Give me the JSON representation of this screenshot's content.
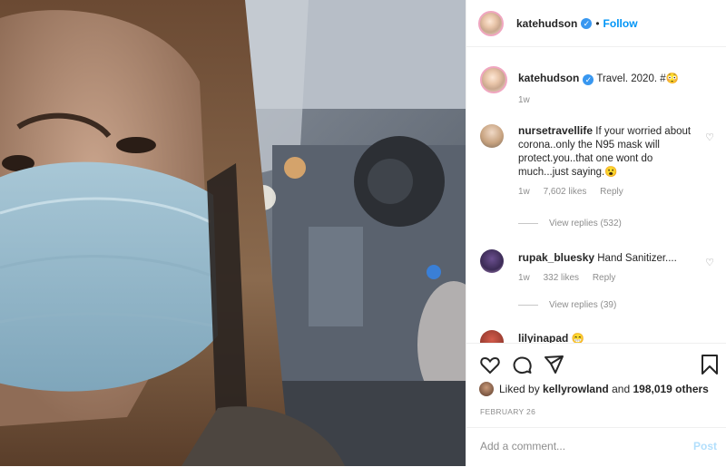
{
  "post": {
    "username": "katehudson",
    "follow_label": "Follow",
    "separator": "•",
    "caption": "Travel. 2020. #😳",
    "caption_age": "1w"
  },
  "comments": [
    {
      "username": "nursetravellife",
      "text": "If your worried about corona..only the N95 mask will protect.you..that one wont do much...just saying.😮",
      "age": "1w",
      "likes": "7,602 likes",
      "reply": "Reply",
      "view_replies": "View replies (532)"
    },
    {
      "username": "rupak_bluesky",
      "text": "Hand Sanitizer....",
      "age": "1w",
      "likes": "332 likes",
      "reply": "Reply",
      "view_replies": "View replies (39)"
    },
    {
      "username": "lilyinapad",
      "text": "😁"
    }
  ],
  "actions": {
    "liked_prefix": "Liked by",
    "liked_user": "kellyrowland",
    "liked_and": "and",
    "liked_others": "198,019 others",
    "date": "FEBRUARY 26",
    "comment_placeholder": "Add a comment...",
    "post_label": "Post"
  },
  "icons": [
    "heart-icon",
    "comment-icon",
    "share-icon",
    "bookmark-icon",
    "verified-badge-icon"
  ],
  "colors": {
    "link": "#0095f6",
    "verified": "#3897f0",
    "muted": "#8e8e8e"
  }
}
